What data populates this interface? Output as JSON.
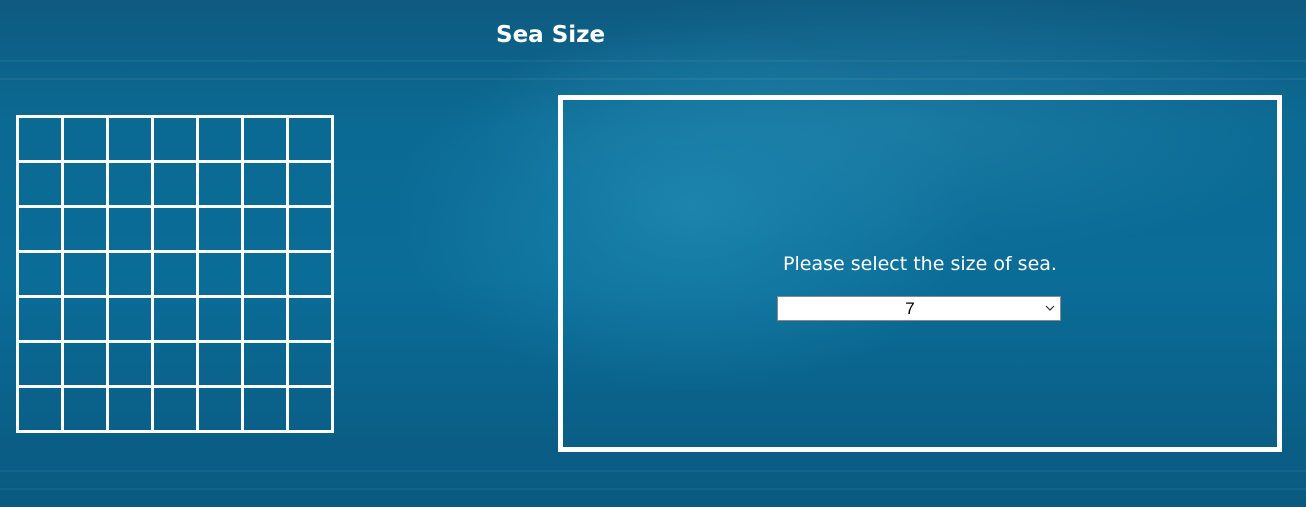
{
  "header": {
    "title": "Sea Size"
  },
  "board": {
    "rows": 7,
    "cols": 7
  },
  "panel": {
    "prompt": "Please select the size of sea.",
    "size_select": {
      "selected_value": "7",
      "icon": "chevron-down-icon"
    }
  },
  "colors": {
    "background": "#0a6d98",
    "lines": "#ffffff"
  }
}
